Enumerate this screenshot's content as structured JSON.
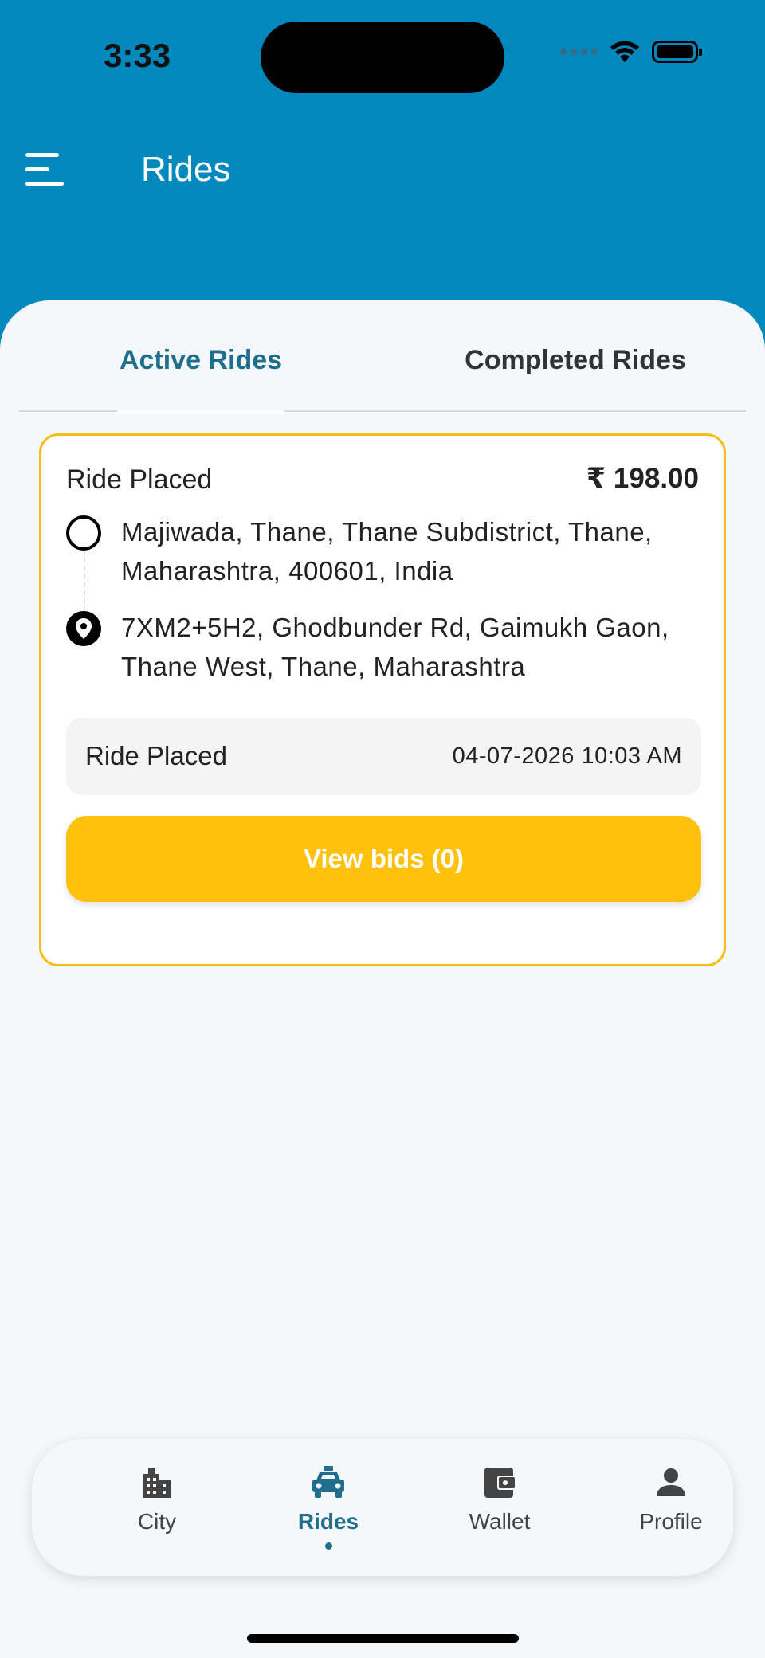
{
  "status_bar": {
    "time": "3:33"
  },
  "header": {
    "title": "Rides"
  },
  "tabs": [
    {
      "label": "Active Rides",
      "active": true
    },
    {
      "label": "Completed Rides",
      "active": false
    }
  ],
  "ride": {
    "status": "Ride Placed",
    "price": "₹ 198.00",
    "pickup": "Majiwada, Thane, Thane Subdistrict, Thane, Maharashtra, 400601, India",
    "drop": "7XM2+5H2, Ghodbunder Rd, Gaimukh Gaon, Thane West, Thane, Maharashtra",
    "status_row_label": "Ride Placed",
    "status_row_time": "04-07-2026 10:03 AM",
    "bids_button": "View bids (0)"
  },
  "bottom_nav": [
    {
      "label": "City",
      "icon": "city-icon",
      "active": false
    },
    {
      "label": "Rides",
      "icon": "taxi-icon",
      "active": true
    },
    {
      "label": "Wallet",
      "icon": "wallet-icon",
      "active": false
    },
    {
      "label": "Profile",
      "icon": "person-icon",
      "active": false
    }
  ],
  "colors": {
    "header_bg": "#0189BE",
    "accent": "#1F6E8C",
    "card_border": "#F6BE17",
    "button": "#FEC20E",
    "page_bg": "#F4F8FB"
  }
}
